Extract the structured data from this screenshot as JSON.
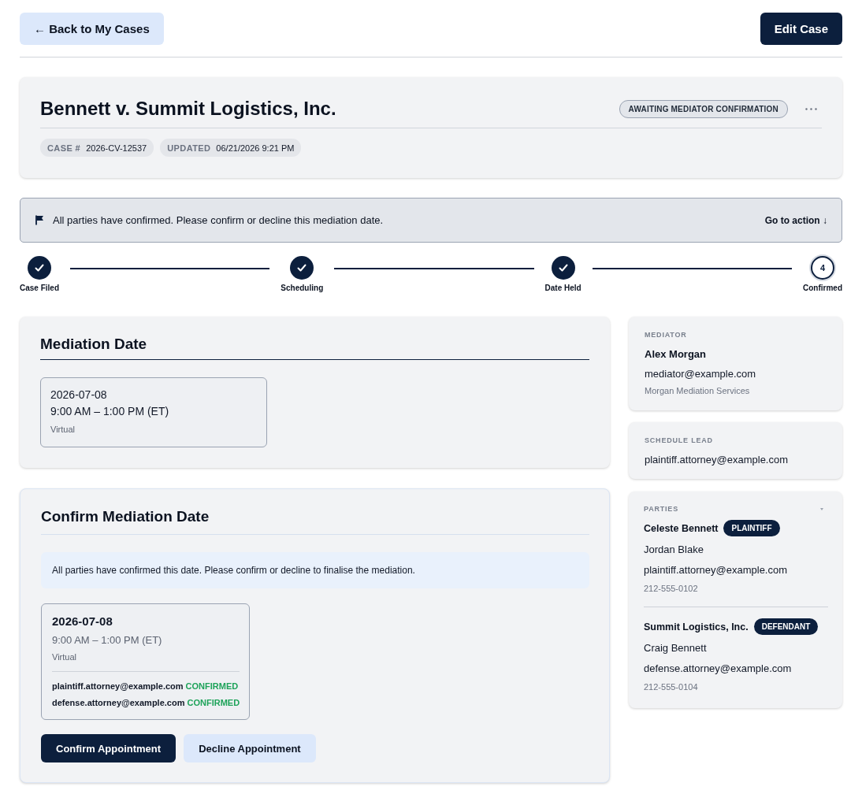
{
  "top_bar": {
    "back_button": "← Back to My Cases",
    "edit_button": "Edit Case"
  },
  "case_header": {
    "title": "Bennett v. Summit Logistics, Inc.",
    "status_badge": "AWAITING MEDIATOR CONFIRMATION",
    "meta": [
      {
        "label": "CASE #",
        "value": "2026-CV-12537"
      },
      {
        "label": "UPDATED",
        "value": "06/21/2026 9:21 PM"
      }
    ]
  },
  "alert": {
    "message": "All parties have confirmed. Please confirm or decline this mediation date.",
    "action": "Go to action ↓"
  },
  "steps": [
    {
      "label": "Case Filed",
      "completed": true
    },
    {
      "label": "Scheduling",
      "completed": true
    },
    {
      "label": "Date Held",
      "completed": true
    },
    {
      "label": "Confirmed",
      "completed": false,
      "number": "4"
    }
  ],
  "mediation_date": {
    "title": "Mediation Date",
    "date": "2026-07-08",
    "time": "9:00 AM – 1:00 PM (ET)",
    "location": "Virtual"
  },
  "confirm_section": {
    "title": "Confirm Mediation Date",
    "info": "All parties have confirmed this date. Please confirm or decline to finalise the mediation.",
    "slot": {
      "date": "2026-07-08",
      "time": "9:00 AM – 1:00 PM (ET)",
      "location": "Virtual",
      "confirmations": [
        {
          "email": "plaintiff.attorney@example.com",
          "status": "CONFIRMED",
          "confirmed": true
        },
        {
          "email": "defense.attorney@example.com",
          "status": "CONFIRMED",
          "confirmed": true
        }
      ]
    },
    "buttons": [
      {
        "label": "Confirm Appointment",
        "kind": "primary"
      },
      {
        "label": "Decline Appointment",
        "kind": "secondary"
      }
    ]
  },
  "mediator": {
    "heading": "MEDIATOR",
    "name": "Alex Morgan",
    "email": "mediator@example.com",
    "organization": "Morgan Mediation Services"
  },
  "schedule_lead": {
    "heading": "SCHEDULE LEAD",
    "email": "plaintiff.attorney@example.com"
  },
  "parties": {
    "heading": "PARTIES",
    "items": [
      {
        "name": "Celeste Bennett",
        "role": "PLAINTIFF",
        "attorney": "Jordan Blake",
        "email": "plaintiff.attorney@example.com",
        "phone": "212-555-0102"
      },
      {
        "name": "Summit Logistics, Inc.",
        "role": "DEFENDANT",
        "attorney": "Craig Bennett",
        "email": "defense.attorney@example.com",
        "phone": "212-555-0104"
      }
    ]
  }
}
